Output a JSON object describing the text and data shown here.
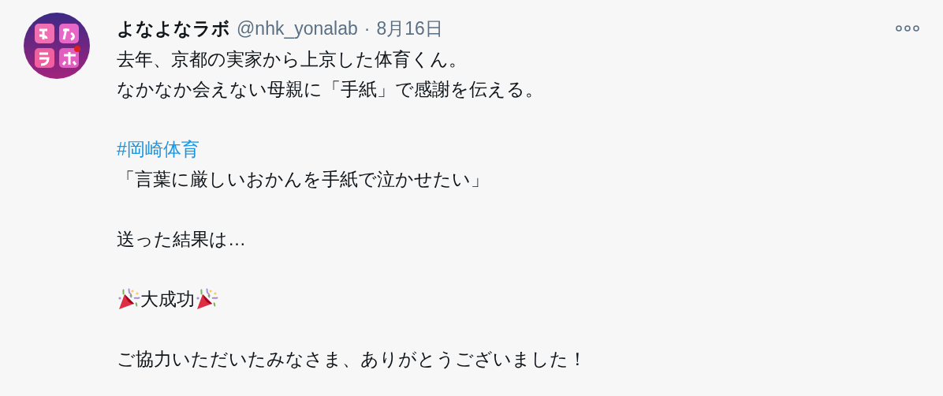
{
  "tweet": {
    "author": {
      "name": "よなよなラボ",
      "handle": "@nhk_yonalab",
      "separator": "·",
      "date": "8月16日"
    },
    "paragraphs": [
      {
        "lines": [
          {
            "kind": "text",
            "text": "去年、京都の実家から上京した体育くん。"
          },
          {
            "kind": "text",
            "text": "なかなか会えない母親に「手紙」で感謝を伝える。"
          }
        ]
      },
      {
        "lines": [
          {
            "kind": "hashtag",
            "text": "#岡崎体育"
          },
          {
            "kind": "text",
            "text": "「言葉に厳しいおかんを手紙で泣かせたい」"
          }
        ]
      },
      {
        "lines": [
          {
            "kind": "text",
            "text": "送った結果は…"
          }
        ]
      },
      {
        "lines": [
          {
            "kind": "celebration",
            "text": "大成功"
          }
        ]
      },
      {
        "lines": [
          {
            "kind": "text",
            "text": "ご協力いただいたみなさま、ありがとうございました！"
          }
        ]
      }
    ]
  }
}
